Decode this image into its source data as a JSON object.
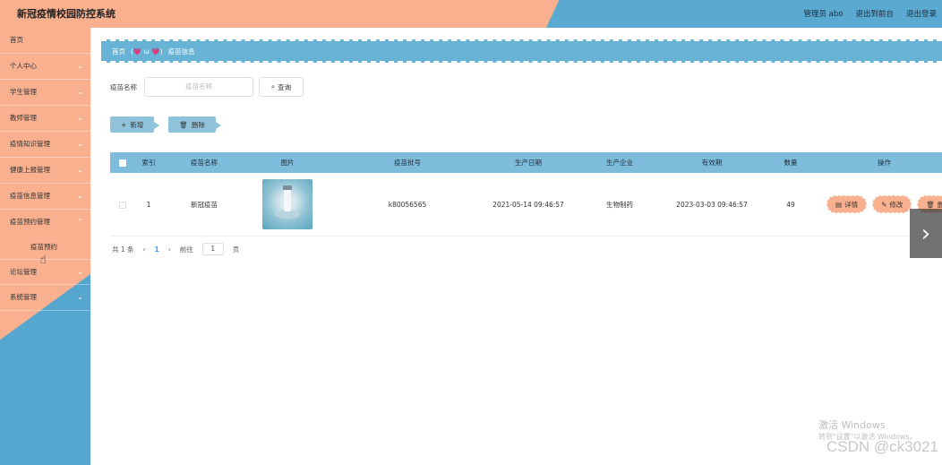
{
  "header": {
    "title": "新冠疫情校园防控系统",
    "admin": "管理员 abo",
    "exit_front": "退出到前台",
    "logout": "退出登录"
  },
  "sidebar": {
    "items": [
      {
        "label": "首页",
        "has_chevron": false
      },
      {
        "label": "个人中心",
        "has_chevron": true
      },
      {
        "label": "学生管理",
        "has_chevron": true
      },
      {
        "label": "教师管理",
        "has_chevron": true
      },
      {
        "label": "疫情知识管理",
        "has_chevron": true
      },
      {
        "label": "健康上报管理",
        "has_chevron": true
      },
      {
        "label": "疫苗信息管理",
        "has_chevron": true
      },
      {
        "label": "疫苗预约管理",
        "has_chevron": true
      }
    ],
    "sub_item": "疫苗预约",
    "items_after": [
      {
        "label": "论坛管理",
        "has_chevron": true
      },
      {
        "label": "系统管理",
        "has_chevron": true
      }
    ]
  },
  "breadcrumb": {
    "home": "首页",
    "emoji": "(💗 ω 💗)",
    "current": "疫苗信息"
  },
  "search": {
    "label": "疫苗名称",
    "placeholder": "疫苗名称",
    "button": "查询"
  },
  "actions": {
    "add": "新增",
    "delete": "删除"
  },
  "table": {
    "headers": [
      "索引",
      "疫苗名称",
      "图片",
      "疫苗批号",
      "生产日期",
      "生产企业",
      "有效期",
      "数量",
      "操作"
    ],
    "rows": [
      {
        "index": "1",
        "name": "新冠疫苗",
        "batch": "k80056565",
        "production_date": "2021-05-14 09:46:57",
        "company": "生物制药",
        "expiry": "2023-03-03 09:46:57",
        "quantity": "49",
        "op_detail": "详情",
        "op_edit": "修改",
        "op_delete": "删除"
      }
    ]
  },
  "pager": {
    "total": "共 1 条",
    "current_page": "1",
    "goto": "前往",
    "page_input": "1",
    "page_unit": "页"
  },
  "watermark": {
    "line1": "激活 Windows",
    "line2": "转到\"设置\"以激活 Windows。",
    "csdn": "CSDN @ck3021"
  },
  "colors": {
    "peach": "#f8b08f",
    "blue": "#5aa9d0"
  }
}
